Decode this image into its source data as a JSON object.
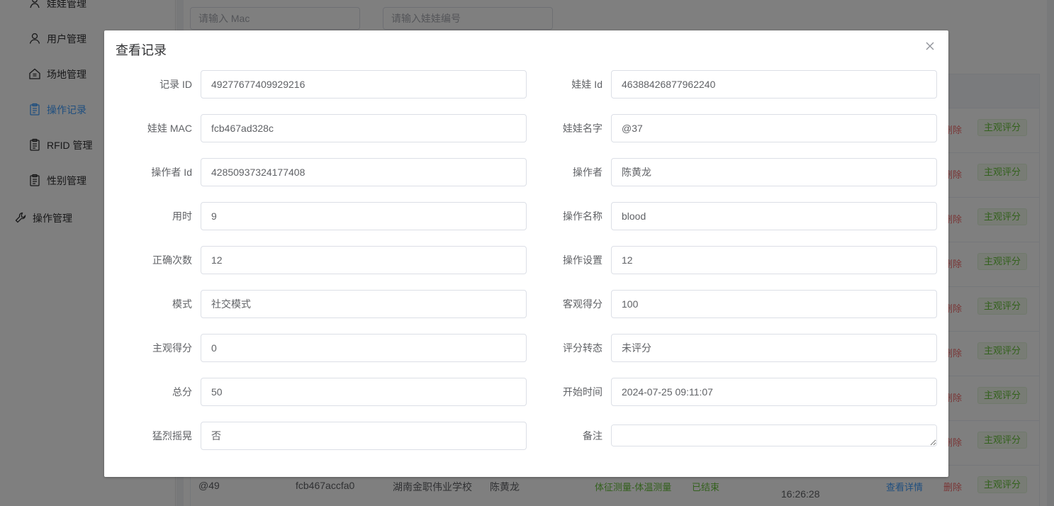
{
  "sidebar": {
    "items": [
      {
        "label": "娃娃管理",
        "icon": "doll-icon",
        "active": false
      },
      {
        "label": "用户管理",
        "icon": "user-icon",
        "active": false
      },
      {
        "label": "场地管理",
        "icon": "site-icon",
        "active": false
      },
      {
        "label": "操作记录",
        "icon": "clipboard-icon",
        "active": true
      },
      {
        "label": "RFID 管理",
        "icon": "clipboard-icon",
        "active": false
      },
      {
        "label": "性别管理",
        "icon": "clipboard-icon",
        "active": false
      }
    ],
    "group": {
      "label": "操作管理",
      "icon": "wrench-icon"
    }
  },
  "filters": {
    "mac_placeholder": "请输入 Mac",
    "doll_no_placeholder": "请输入娃娃编号"
  },
  "table": {
    "actions": {
      "delete": "删除",
      "subjective": "主观评分",
      "detail": "查看详情"
    },
    "last_row": {
      "name": "@49",
      "mac": "fcb467accfa0",
      "school": "湖南金职伟业学校",
      "operator": "陈黄龙",
      "operation": "体征测量-体温测量",
      "status": "已结束",
      "time": "16:26:28"
    }
  },
  "dialog": {
    "title": "查看记录",
    "fields_left": [
      {
        "label": "记录 ID",
        "value": "49277677409929216"
      },
      {
        "label": "娃娃 MAC",
        "value": "fcb467ad328c"
      },
      {
        "label": "操作者 Id",
        "value": "42850937324177408"
      },
      {
        "label": "用时",
        "value": "9"
      },
      {
        "label": "正确次数",
        "value": "12"
      },
      {
        "label": "模式",
        "value": "社交模式"
      },
      {
        "label": "主观得分",
        "value": "0"
      },
      {
        "label": "总分",
        "value": "50"
      },
      {
        "label": "猛烈摇晃",
        "value": "否"
      }
    ],
    "fields_right": [
      {
        "label": "娃娃 Id",
        "value": "46388426877962240"
      },
      {
        "label": "娃娃名字",
        "value": "@37"
      },
      {
        "label": "操作者",
        "value": "陈黄龙"
      },
      {
        "label": "操作名称",
        "value": "blood"
      },
      {
        "label": "操作设置",
        "value": "12"
      },
      {
        "label": "客观得分",
        "value": "100"
      },
      {
        "label": "评分转态",
        "value": "未评分"
      },
      {
        "label": "开始时间",
        "value": "2024-07-25 09:11:07"
      },
      {
        "label": "备注",
        "value": ""
      }
    ]
  }
}
